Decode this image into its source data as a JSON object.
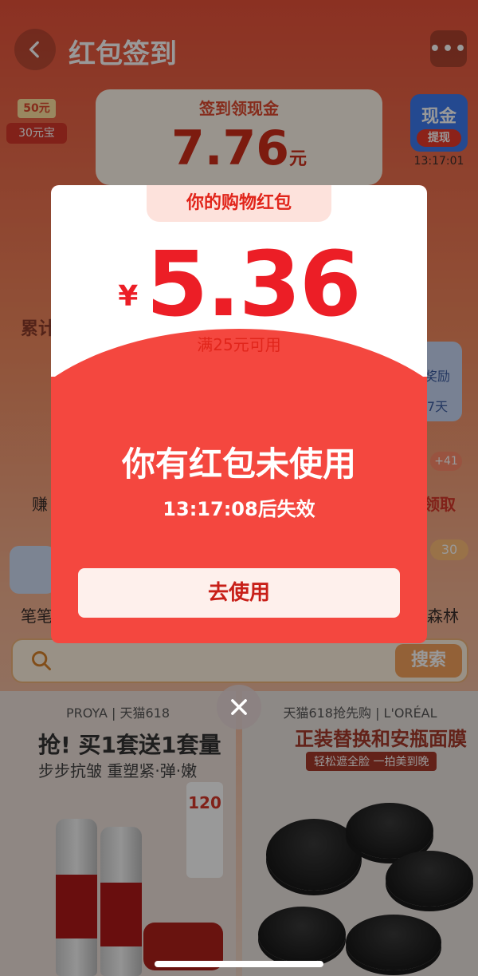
{
  "header": {
    "title": "红包签到",
    "more": "•••"
  },
  "signin": {
    "title": "签到领现金",
    "amount": "7.76",
    "unit": "元"
  },
  "coupon_left": {
    "top": "50元",
    "bottom": "30元宝"
  },
  "cash_right": {
    "label": "现金",
    "button": "提现",
    "time": "13:17:01"
  },
  "background_labels": {
    "left_1": "累计",
    "right_1": "奖励",
    "right_1b": "7天",
    "left_2": "赚",
    "right_2": "领取",
    "pill_41": "+41",
    "left_3": "笔笔",
    "right_3": "森林",
    "pill_30": "30"
  },
  "search": {
    "button": "搜索"
  },
  "ads": {
    "left": {
      "brand": "PROYA | 天猫618",
      "headline": "抢! 买1套送1套量",
      "sub": "步步抗皱 重塑紧·弹·嫩",
      "tag_value": "120"
    },
    "right": {
      "brand": "天猫618抢先购 | L'ORÉAL",
      "headline": "正装替换和安瓶面膜",
      "sub": "轻松遮全脸 一拍美到晚"
    }
  },
  "modal": {
    "tag": "你的购物红包",
    "currency": "¥",
    "amount": "5.36",
    "condition": "满25元可用",
    "message": "你有红包未使用",
    "expire": "13:17:08后失效",
    "button": "去使用"
  },
  "colors": {
    "modal_red": "#f4473f",
    "amount_red": "#ec1e26",
    "button_bg": "#fef0ec"
  }
}
